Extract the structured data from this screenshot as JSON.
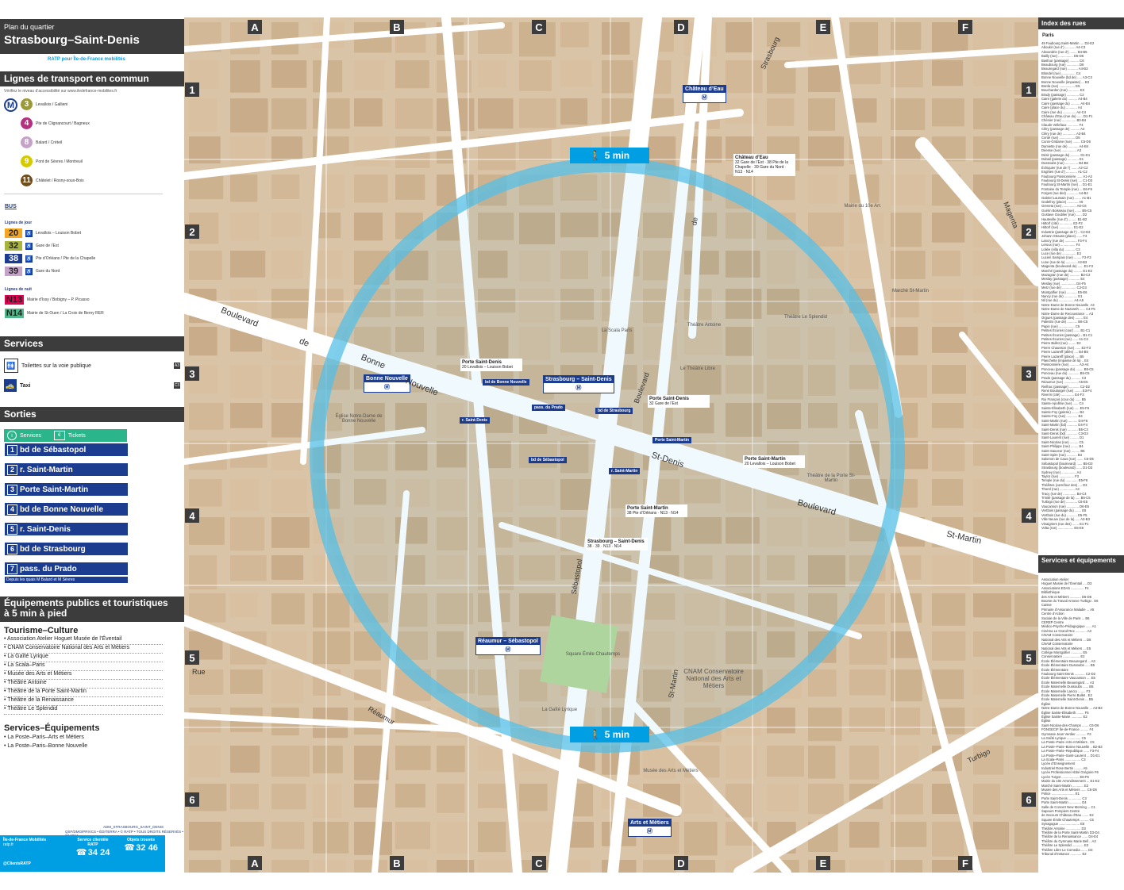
{
  "header": {
    "kicker": "Plan du quartier",
    "title": "Strasbourg–Saint-Denis",
    "logo_text": "RATP pour Île-de-France mobilités"
  },
  "transport": {
    "title": "Lignes de transport en commun",
    "note": "Vérifiez le niveau d’accessibilité sur www.iledefrance-mobilites.fr",
    "metro": [
      {
        "line": "3",
        "color": "#9a9a3a",
        "dest": "Levallois / Gallieni"
      },
      {
        "line": "4",
        "color": "#b3317e",
        "dest": "Pte de Clignancourt / Bagneux"
      },
      {
        "line": "8",
        "color": "#c5a3c9",
        "dest": "Balard / Créteil"
      },
      {
        "line": "9",
        "color": "#d5c900",
        "dest": "Pont de Sèvres / Montreuil"
      },
      {
        "line": "11",
        "color": "#704b1c",
        "dest": "Châtelet / Rosny-sous-Bois"
      }
    ],
    "bus_title": "BUS",
    "bus_day_title": "Lignes de jour",
    "bus_day": [
      {
        "line": "20",
        "bg": "#f5a623",
        "fg": "#222",
        "dest": "Levallois – Louison Bobet"
      },
      {
        "line": "32",
        "bg": "#a9b53c",
        "fg": "#222",
        "dest": "Gare de l’Est"
      },
      {
        "line": "38",
        "bg": "#1b3c8f",
        "fg": "#fff",
        "dest": "Pte d’Orléans / Pte de la Chapelle"
      },
      {
        "line": "39",
        "bg": "#c5a3c9",
        "fg": "#222",
        "dest": "Gare du Nord"
      }
    ],
    "bus_night_title": "Lignes de nuit",
    "bus_night": [
      {
        "line": "N13",
        "bg": "#e40051",
        "fg": "#222",
        "dest": "Mairie d’Issy / Bobigny – P. Picasso"
      },
      {
        "line": "N14",
        "bg": "#52b788",
        "fg": "#222",
        "dest": "Mairie de St-Ouen / La Croix de Berny RER"
      }
    ]
  },
  "services": {
    "title": "Services",
    "items": [
      {
        "label": "Toilettes sur la voie publique",
        "ref": "A3"
      },
      {
        "label": "Taxi",
        "ref": "C3"
      }
    ]
  },
  "sorties": {
    "title": "Sorties",
    "header_left": "Services",
    "header_right": "Tickets",
    "items": [
      {
        "num": "1",
        "label": "bd de Sébastopol"
      },
      {
        "num": "2",
        "label": "r. Saint-Martin"
      },
      {
        "num": "3",
        "label": "Porte Saint-Martin"
      },
      {
        "num": "4",
        "label": "bd de Bonne Nouvelle"
      },
      {
        "num": "5",
        "label": "r. Saint-Denis"
      },
      {
        "num": "6",
        "label": "bd de Strasbourg"
      },
      {
        "num": "7",
        "label": "pass. du Prado"
      }
    ],
    "footnote": "Depuis les quais M Balard et M Sèvres"
  },
  "equipements": {
    "title": "Équipements publics et touristiques à 5 min à pied",
    "tourisme_title": "Tourisme–Culture",
    "tourisme": [
      "Association Atelier Hoguet Musée de l’Éventail",
      "CNAM Conservatoire National des Arts et Métiers",
      "La Gaîté Lyrique",
      "La Scala–Paris",
      "Musée des Arts et Métiers",
      "Théâtre Antoine",
      "Théâtre de la Porte Saint-Martin",
      "Théâtre de la Renaissance",
      "Théâtre Le Splendid"
    ],
    "services_title": "Services–Équipements",
    "services": [
      "La Poste–Paris–Arts et Métiers",
      "La Poste–Paris–Bonne Nouvelle"
    ]
  },
  "footer": {
    "code": "ADM_STRASBOURG_SAINT_DENIS",
    "credits": "QSF/DMO/PRIVCS • ÉDITERRA • © RATP • TOUS DROITS RÉSERVÉS • 07.2024",
    "contacts": [
      {
        "title": "Île-de-France Mobilités",
        "value": "ratp.fr"
      },
      {
        "title": "Service clientèle RATP",
        "value": "34 24"
      },
      {
        "title": "Objets trouvés",
        "value": "32 46"
      }
    ],
    "social": "@ClientsRATP"
  },
  "grid": {
    "cols": [
      "A",
      "B",
      "C",
      "D",
      "E",
      "F"
    ],
    "rows": [
      "1",
      "2",
      "3",
      "4",
      "5",
      "6"
    ]
  },
  "map": {
    "walk_label": "5 min",
    "stations": [
      {
        "name": "Château d’Eau"
      },
      {
        "name": "Bonne Nouvelle"
      },
      {
        "name": "Strasbourg – Saint-Denis"
      },
      {
        "name": "Réaumur – Sébastopol"
      },
      {
        "name": "Arts et Métiers"
      }
    ],
    "exit_tags": [
      "bd de Bonne Nouvelle",
      "r. Saint-Denis",
      "pass. du Prado",
      "bd de Strasbourg",
      "bd de Sébastopol",
      "r. Saint-Martin",
      "Porte Saint-Martin"
    ],
    "streets": [
      {
        "name": "Boulevard"
      },
      {
        "name": "de"
      },
      {
        "name": "Bonne"
      },
      {
        "name": "Nouvelle"
      },
      {
        "name": "St-Denis"
      },
      {
        "name": "Boulevard"
      },
      {
        "name": "St-Martin"
      },
      {
        "name": "Sébastopol"
      },
      {
        "name": "Boulevard"
      },
      {
        "name": "de"
      },
      {
        "name": "Strasbourg"
      },
      {
        "name": "Magenta"
      },
      {
        "name": "Rue"
      },
      {
        "name": "Réaumur"
      },
      {
        "name": "St-Martin"
      },
      {
        "name": "Turbigo"
      }
    ],
    "pois": [
      {
        "name": "CNAM Conservatoire National des Arts et Métiers"
      },
      {
        "name": "Square Émile Chautemps"
      },
      {
        "name": "Théâtre de la Porte St-Martin"
      },
      {
        "name": "La Scala Paris"
      },
      {
        "name": "Théâtre Antoine"
      },
      {
        "name": "Marché St-Martin"
      },
      {
        "name": "Mairie du 10e Arr."
      },
      {
        "name": "Église Notre-Dame de Bonne Nouvelle"
      },
      {
        "name": "La Gaîté Lyrique"
      },
      {
        "name": "Musée des Arts et Métiers"
      },
      {
        "name": "Théâtre Le Splendid"
      },
      {
        "name": "Le Théâtre Libre"
      }
    ],
    "stop_cards": [
      {
        "title": "Porte Saint-Denis",
        "lines": "20 Levallois – Louison Bobet"
      },
      {
        "title": "Porte Saint-Martin",
        "lines": "20 Levallois – Louison Bobet"
      },
      {
        "title": "Château d’Eau",
        "lines": "32 Gare de l’Est · 38 Pte de la Chapelle · 39 Gare du Nord · N13 · N14"
      },
      {
        "title": "Porte Saint-Denis",
        "lines": "32 Gare de l’Est"
      },
      {
        "title": "Porte Saint-Martin",
        "lines": "38 Pte d’Orléans · N13 · N14"
      },
      {
        "title": "Strasbourg – Saint-Denis",
        "lines": "38 · 39 · N13 · N14"
      }
    ]
  },
  "right_panel": {
    "index_title": "Index des rues",
    "index_city": "Paris",
    "index_text": "49 Faubourg Saint-Martin .... D2-E2\nAboukir (rue d’) ........... A4-C3\nAlexandrie (rue d’) ........ B4-B5\nBailly (rue) ................ D5-D6\nBasfour (passage) .......... C6\nBeaubourg (rue) ............. D6\nBeauregard (rue) ........... A4-B3\nBlondel (rue) ............... C4\nBonne Nouvelle (bd de) ..... A3-C3\nBonne Nouvelle (impasse) ... B3\nBorda (rue) ................. E5\nBouchardon (rue) ............ E3\nBrady (passage) ............. C2\nCaire (galerie du) .......... A4-B4\nCaire (passage du) .......... A4-B4\nCaire (place du) ............ A4\nCaire (rue du) .............. A4-C4\nChâteau d’Eau (rue du) ...... D1-F1\nChénier (rue) ............... B3-B4\nClaude Vellefaux ............ F4\nCléry (passage de) .......... A4\nCléry (rue de) .............. A3-B4\nConté (rue) ................. D5\nCunin-Gridaine (rue) ........ C5-D6\nDamiette (rue de) ........... A4-B4\nDéesse (rue) ................ A3\nDésir (passage du) .......... D1-E1\nDubail (passage) ............ E1\nDussoubs (rue) .............. B4-B6\nÉchiquier (rue de l’) ....... A2-C2\nEnghien (rue d’) ............ A1-C2\nFaubourg Poissonnière ...... A1-A2\nFaubourg St-Denis (rue) .... C1-D3\nFaubourg St-Martin (rue) ... D1-E1\nFontaine du Temple (rue) ... E6-F6\nForges (rue des) ............ A4-B4\nGabriel Laumain (rue) ....... A1-B1\nGodefroy (place) ............ A6\nGreneta (rue) ............... A6-C6\nGuérin Boisseau (rue) ....... B5-C5\nGustave Goublier (rue) ...... D2\nHauteville (rue d’) ......... B1-B2\nHittorf (cité) .............. E2-F2\nHittorf (rue) ............... E1-E2\nIndustrie (passage de l’) .. C2-D2\nJohann Strauss (place) ...... F4\nLancry (rue de) ............. F3-F4\nLeroux (rue) ................ F4\nLoliée (villa du) ........... C3\nLuce (rue de) ............... E3\nLucien Sampaix (rue) ........ F2-F3\nLune (rue de la) ............ A3-B3\nMagenta (boulevard de) ...... E1-F2\nMarché (passage du) ......... E1-E2\nMazagran (rue de) ........... B3-C2\nMeslay (passage) ............ E4\nMeslay (rue) ................ D4-F5\nMetz (rue de) ............... C2-D3\nMontgolfier (rue) ........... E5-E6\nNancy (rue de) .............. E1\nNil (rue du) ................ A4-A5\nNotre-Dame de Bonne Nouvelle  A3\nNotre-Dame de Nazareth ...... C4-F5\nNotre-Dame de Recouvrance ... A3\nOrgues (passage des) ........ E4\nPalestro (rue de) ........... B6-C5\nPapin (rue) ................. C5\nPetites Écuries (cour) ...... B1-C1\nPetites Écuries (passage) .. B1-C1\nPetites Écuries (rue) ...... A1-C2\nPierre Bullet (rue) ........ E2\nPierre Chausson (rue) ...... E2-F3\nPierre Lazareff (allée) .... B4-B5\nPierre Lazareff (place) .... B5\nPlanchette (impasse de la) .. E4\nPoissonnière (rue) .......... A3-A4\nPonceau (passage du) ........ B5-C5\nPonceau (rue du) ............ B5-C5\nPrado (passage du) .......... C3\nRéaumur (rue) ............... A5-E5\nReilhac (passage) ........... C2-D2\nRené Boulanger (rue) ........ E3-F4\nRiverin (cité) .............. E4-F3\nRoi François (cour du) ...... B5\nSainte-Apolline (rue) ...... C4\nSainte-Élisabeth (rue) ..... E5-F6\nSainte-Foy (galerie) ........ B4\nSainte-Foy (rue) ............ B4\nSaint-Martin (rue) .......... D4-F6\nSaint-Martin (bd) ........... D4-F4\nSaint-Denis (rue) ........... B5-C3\nSaint-Denis (bd) ............ C3-D3\nSaint-Laurent (rue) ......... D1\nSaint-Nicolas (rue) ......... C5\nSaint-Philippe (rue) ........ B4\nSaint-Sauveur (rue) ......... B5\nSaint-Spire (rue) ........... B4\nSalomon de Caus (rue) ....... C5-D5\nSébastopol (boulevard) ...... B5-D3\nStrasbourg (boulevard) ...... D1-D3\nSydney (rue) ................ A4\nTaylor (rue) ................ F3\nTemple (rue du) ............. E5-F6\nThéâtres (carrefour des) .... D3\nThorel (rue) ................ A3\nTracy (rue de) .............. B4-C4\nTrinité (passage de la) ..... B5-C5\nTurbigo (rue de) ............ C6-E5\nVaucanson (rue) ............. D6-E5\nVertbois (passage du) ....... E5\nVertbois (rue du) ........... E5-F5\nVille Neuve (rue de la) ..... A3-B3\nVinaigriers (rue des) ....... E1-F1\nVolta (rue) ................. E5-E6",
    "services_title": "Services et équipements",
    "services_text": "Association Atelier\nHoguet Musée de l’Éventail .... D3\nAssociations EDAS .............. F4\nBibliothèque\ndes Arts et Métiers ............ D5-D6\nBourse du Travail Annexe Turbigo . E6\nCaisse\nPrimaire d’Assurance Maladie ... A5\nCentre d’Action\nSociale de la Ville de Paris ... B6\nCEREP Centre\nMédico-Psycho-Pédagogique ...... A1\nCinéma Le Grand Rex ............ A3\nCNAM Conservatoire\nNational des Arts et Métiers ... D5\nCNAM Conservatoire\nNational des Arts et Métiers ... E5\nCollège Montgolfier ............ E5\nConservatoire .................. E2\nÉcole Élémentaire Beauregard ... A3\nÉcole Élémentaire Dussoubs ..... B5\nÉcole Élémentaire\nFaubourg Saint-Denis ........... C2-D2\nÉcole Élémentaire Vaucanson .... E5\nÉcole Maternelle Beauregard .... A3\nÉcole Maternelle Dussoubs ...... B5\nÉcole Maternelle Lancry ........ F3\nÉcole Maternelle Pierre Bullet . E2\nÉcole Maternelle Saint-Denis ... B5\nÉglise\nNotre-Dame de Bonne Nouvelle ... A3-B3\nÉglise Sainte-Élisabeth ........ F5\nÉglise Sainte-Marie ............ E2\nÉglise\nSaint-Nicolas-des-Champs ....... C6-D6\nFONGECIF Île-de-France ......... F4\nGymnase Jean Verdier ........... F3\nLa Gaîté Lyrique ............... C5\nLa Poste–Paris–Arts et Métiers . C5\nLa Poste–Paris–Bonne Nouvelle .. B2-B3\nLa Poste–Paris–Republique ...... F3-F4\nLa Poste–Paris–Saint-Laurent ... D1-E1\nLa Scala–Paris ................. C3\nLycée d’Enseignement\nIndustriel Rose Bertin ......... A5\nLycée Professionnel Abbé Grégoire F6\nLycée Turgot ................... E6-F6\nMairie du 10e Arrondissement ... E1-E2\nMarché Saint-Martin ............ E2\nMusée des Arts et Métiers ...... C6-D6\nPolice ......................... E1\nPorte Saint-Denis .............. C3\nPorte Saint-Martin ............. D4\nSalle de Concert New Morning ... C1\nSapeurs Pompiers Centre\nde Secours Château d’Eau ....... E2\nSquare Émile Chautemps ......... C5\nSynagogue ...................... E5\nThéâtre Antoine ................ D3\nThéâtre de la Porte Saint-Martin D3-D4\nThéâtre de la Renaissance ...... D4-E4\nThéâtre du Gymnase Marie Bell .. A3\nThéâtre Le Splendid ............ E3\nThéâtre Libre Le Comedia ....... D3\nTribunal d’Instance ............ E2"
  }
}
